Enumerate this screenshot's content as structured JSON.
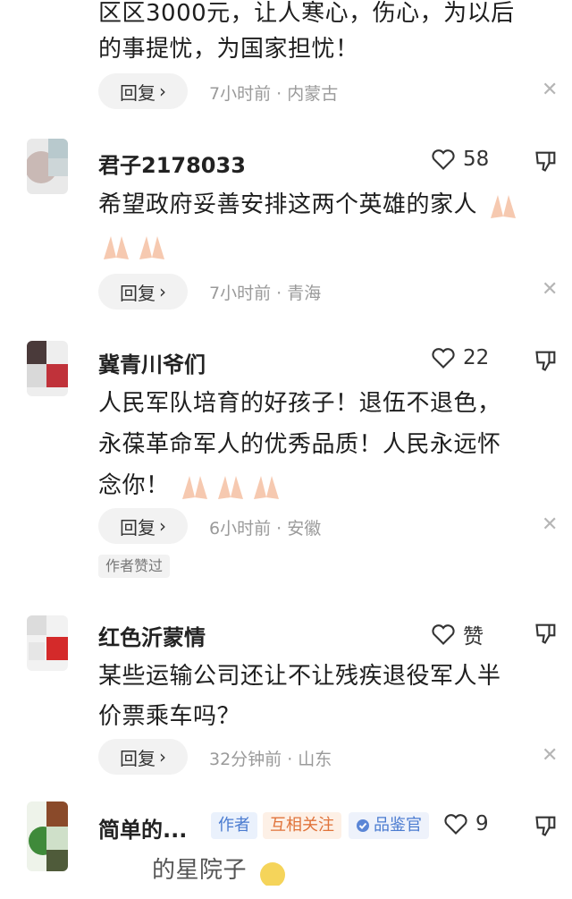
{
  "top_comment": {
    "line1": "区区3000元，让人寒心，伤心，为以后",
    "line2": "的事提忧，为国家担忧！",
    "reply": "回复",
    "meta": "7小时前 · 内蒙古"
  },
  "comments": [
    {
      "name": "君子2178033",
      "likes": "58",
      "lines": [
        "希望政府妥善安排这两个英雄的家人"
      ],
      "reply": "回复",
      "meta": "7小时前 · 青海"
    },
    {
      "name": "冀青川爷们",
      "likes": "22",
      "lines": [
        "人民军队培育的好孩子！退伍不退色，",
        "永葆革命军人的优秀品质！人民永远怀",
        "念你！"
      ],
      "reply": "回复",
      "meta": "6小时前 · 安徽",
      "author_liked": "作者赞过"
    },
    {
      "name": "红色沂蒙情",
      "likes": "赞",
      "lines": [
        "某些运输公司还让不让残疾退役军人半",
        "价票乘车吗？"
      ],
      "reply": "回复",
      "meta": "32分钟前 · 山东"
    },
    {
      "name": "简单的...",
      "likes": "9",
      "badges": {
        "author": "作者",
        "mutual": "互相关注",
        "reviewer": "品鉴官"
      },
      "partial_line": "的星院子"
    }
  ],
  "colors": {
    "badge_blue": "#4a7bd0",
    "badge_orange": "#e0733a",
    "emoji_skin": "#f6c9b0"
  }
}
